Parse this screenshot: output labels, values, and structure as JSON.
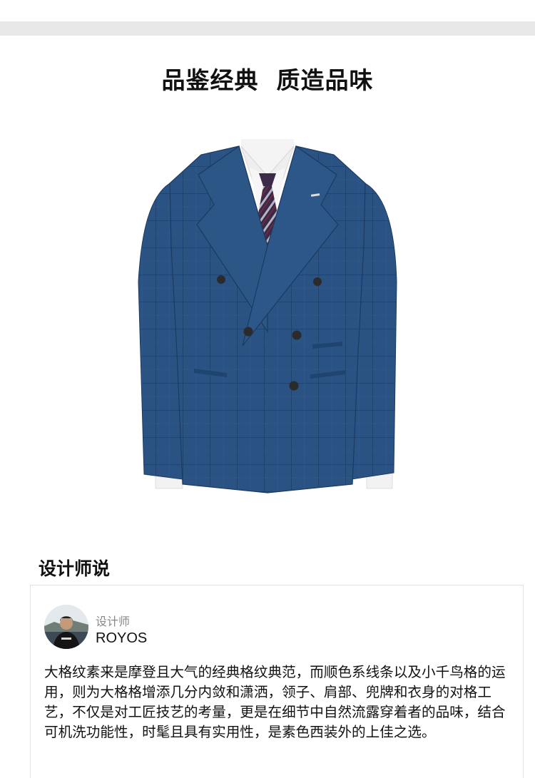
{
  "headline": "品鉴经典  质造品味",
  "product": {
    "image_name": "double-breasted-blue-check-suit-jacket",
    "colors": {
      "jacket": "#2a5384",
      "jacket_dark": "#1b3a60",
      "shirt": "#f4f4f4",
      "tie": "#3b2b48",
      "button": "#2b2b2b"
    }
  },
  "designer_section": {
    "title": "设计师说",
    "role": "设计师",
    "name": "ROYOS",
    "quote": "大格纹素来是摩登且大气的经典格纹典范，而顺色系线条以及小千鸟格的运用，则为大格格增添几分内敛和潇洒，领子、肩部、兜牌和衣身的对格工艺，不仅是对工匠技艺的考量，更是在细节中自然流露穿着者的品味，结合可机洗功能性，时髦且具有实用性，是素色西装外的上佳之选。"
  }
}
